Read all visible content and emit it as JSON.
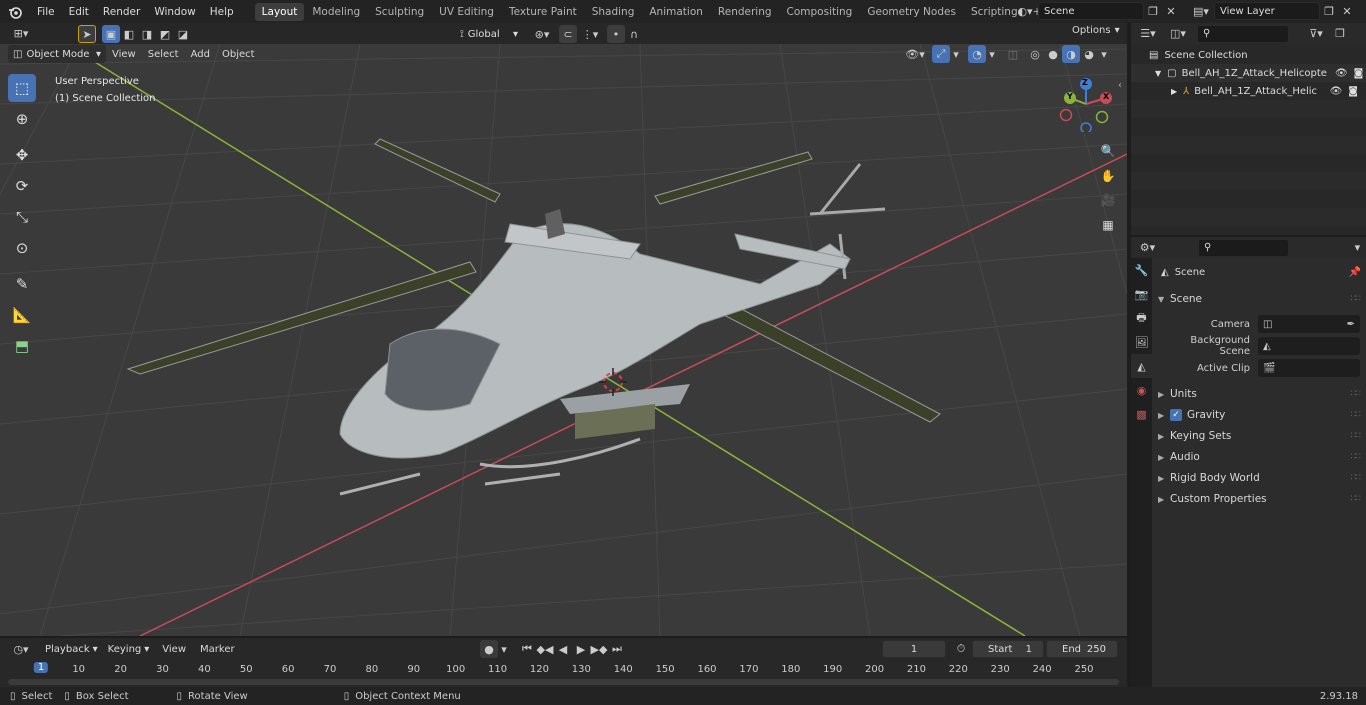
{
  "topbar": {
    "menus": [
      "File",
      "Edit",
      "Render",
      "Window",
      "Help"
    ],
    "workspaces": [
      {
        "label": "Layout",
        "active": true
      },
      {
        "label": "Modeling",
        "active": false
      },
      {
        "label": "Sculpting",
        "active": false
      },
      {
        "label": "UV Editing",
        "active": false
      },
      {
        "label": "Texture Paint",
        "active": false
      },
      {
        "label": "Shading",
        "active": false
      },
      {
        "label": "Animation",
        "active": false
      },
      {
        "label": "Rendering",
        "active": false
      },
      {
        "label": "Compositing",
        "active": false
      },
      {
        "label": "Geometry Nodes",
        "active": false
      },
      {
        "label": "Scripting",
        "active": false
      }
    ],
    "add_tab": "+",
    "scene": "Scene",
    "view_layer": "View Layer"
  },
  "viewport_header": {
    "mode": "Object Mode",
    "menus": [
      "View",
      "Select",
      "Add",
      "Object"
    ],
    "orientation": "Global",
    "options": "Options"
  },
  "viewport": {
    "perspective": "User Perspective",
    "collection": "(1) Scene Collection",
    "axis_labels": {
      "x": "X",
      "y": "Y",
      "z": "Z"
    },
    "colors": {
      "x_axis": "#c84c58",
      "y_axis": "#8ab438",
      "z_axis": "#3d80d9",
      "active": "#4772b3"
    }
  },
  "outliner": {
    "root": "Scene Collection",
    "collection": "Bell_AH_1Z_Attack_Helicopte",
    "object": "Bell_AH_1Z_Attack_Helic"
  },
  "properties": {
    "header": "Scene",
    "panel_title": "Scene",
    "fields": [
      {
        "label": "Camera",
        "value": ""
      },
      {
        "label": "Background Scene",
        "value": ""
      },
      {
        "label": "Active Clip",
        "value": ""
      }
    ],
    "panels": [
      "Units",
      "Gravity",
      "Keying Sets",
      "Audio",
      "Rigid Body World",
      "Custom Properties"
    ]
  },
  "timeline": {
    "menus": [
      "Playback",
      "Keying",
      "View",
      "Marker"
    ],
    "current_frame": "1",
    "start_label": "Start",
    "start": "1",
    "end_label": "End",
    "end": "250",
    "ticks": [
      "1",
      "10",
      "20",
      "30",
      "40",
      "50",
      "60",
      "70",
      "80",
      "90",
      "100",
      "110",
      "120",
      "130",
      "140",
      "150",
      "160",
      "170",
      "180",
      "190",
      "200",
      "210",
      "220",
      "230",
      "240",
      "250"
    ]
  },
  "statusbar": {
    "items": [
      "Select",
      "Box Select",
      "Rotate View",
      "Object Context Menu"
    ],
    "version": "2.93.18"
  }
}
